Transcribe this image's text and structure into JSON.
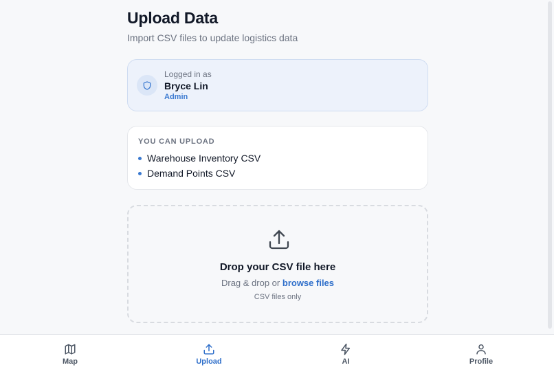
{
  "header": {
    "title": "Upload Data",
    "subtitle": "Import CSV files to update logistics data"
  },
  "user": {
    "label": "Logged in as",
    "name": "Bryce Lin",
    "role": "Admin",
    "icon": "shield-icon"
  },
  "upload_types": {
    "heading": "YOU CAN UPLOAD",
    "items": [
      "Warehouse Inventory CSV",
      "Demand Points CSV"
    ]
  },
  "dropzone": {
    "icon": "upload-icon",
    "title": "Drop your CSV file here",
    "hint_prefix": "Drag & drop or",
    "browse_label": "browse files",
    "note": "CSV files only"
  },
  "nav": {
    "active": "Upload",
    "items": [
      {
        "label": "Map",
        "icon": "map-icon"
      },
      {
        "label": "Upload",
        "icon": "upload-icon"
      },
      {
        "label": "AI",
        "icon": "bolt-icon"
      },
      {
        "label": "Profile",
        "icon": "user-icon"
      }
    ]
  },
  "colors": {
    "accent": "#2f6fca",
    "card_highlight_bg": "#edf2fb",
    "text_primary": "#111827",
    "text_muted": "#6b7280"
  }
}
